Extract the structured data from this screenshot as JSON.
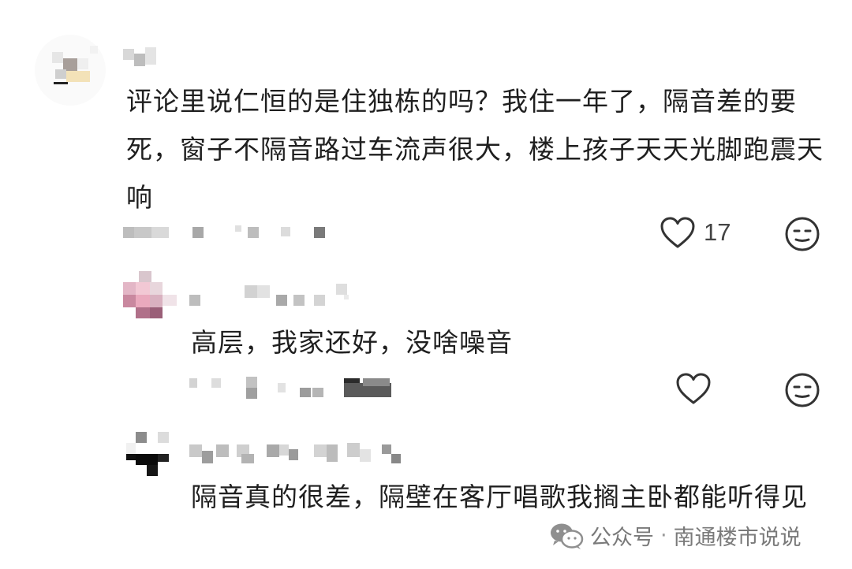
{
  "comments": [
    {
      "text": "评论里说仁恒的是住独栋的吗？我住一年了，隔音差的要死，窗子不隔音路过车流声很大，楼上孩子天天光脚跑震天响",
      "like_count": "17",
      "like_icon": "heart-outline",
      "dislike_icon": "meh-face"
    },
    {
      "text": "高层，我家还好，没啥噪音",
      "like_icon": "heart-outline",
      "dislike_icon": "meh-face"
    },
    {
      "text": "隔音真的很差，隔壁在客厅唱歌我搁主卧都能听得见"
    }
  ],
  "watermark": {
    "prefix": "公众号",
    "separator": "·",
    "account": "南通楼市说说",
    "icon": "wechat-icon"
  },
  "colors": {
    "text": "#1f1f1f",
    "icon": "#333333",
    "muted": "#7a7a7a"
  }
}
